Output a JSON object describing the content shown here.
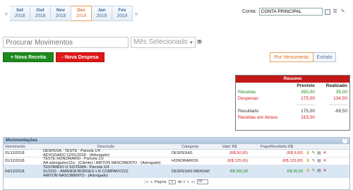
{
  "month_nav": {
    "months": [
      {
        "name": "Set",
        "year": "2018"
      },
      {
        "name": "Out",
        "year": "2018"
      },
      {
        "name": "Nov",
        "year": "2018"
      },
      {
        "name": "Dez",
        "year": "2018"
      },
      {
        "name": "Jan",
        "year": "2019"
      },
      {
        "name": "Fev",
        "year": "2019"
      }
    ],
    "active_index": 3,
    "prev_icon": "double-chevron-left-icon",
    "next_icon": "double-chevron-right-icon"
  },
  "conta": {
    "label": "Conta:",
    "selected": "CONTA PRINCIPAL"
  },
  "search": {
    "placeholder": "Procurar Movimentos",
    "month_select": "Mês Selecionado"
  },
  "actions": {
    "nova_receita": "+ Nova Receita",
    "nova_despesa": "- Nova Despesa",
    "por_vencimento": "Por Vencimento",
    "extrato": "Extrato"
  },
  "resumo": {
    "title": "Resumo",
    "col_previsto": "Previsto",
    "col_realizado": "Realizado",
    "rows": [
      {
        "label": "Receitas",
        "previsto": "350,00",
        "realizado": "35,00"
      },
      {
        "label": "Despesas",
        "previsto": "175,00",
        "realizado": "134,50"
      }
    ],
    "separator": "------------",
    "resultado": {
      "label": "Resultado",
      "previsto": "175,00",
      "realizado": "-99,50"
    },
    "atraso": {
      "label": "Receitas em Atraso",
      "previsto": "315,00",
      "realizado": ""
    }
  },
  "movimentacoes": {
    "title": "Movimentações",
    "columns": [
      "Vencimento",
      "Descrição",
      "Categoria",
      "Valor R$",
      "Pago/Recebido R$"
    ],
    "rows": [
      {
        "vencimento": "01/12/2018",
        "descricao_1": "DESPESA - TESTE - Parcela 1/4",
        "descricao_2": "ADVOGADO 12/01/2018 - (Advogado)",
        "categoria": "DESPESAS",
        "valor": "(R$ 50,00)",
        "pago": "(R$ 9,50)",
        "kind": "neg"
      },
      {
        "vencimento": "01/12/2018",
        "descricao_1": "TESTE HONORARIO - Parcela 1/2",
        "descricao_2": "AA advogados12a - (Cliente) / AIRTON NASCIMENTO - (Advogado)",
        "categoria": "HONORÁRIOS",
        "valor": "(R$ 125,00)",
        "pago": "(R$ 125,00)",
        "kind": "neg"
      },
      {
        "vencimento": "04/12/2018",
        "descricao_1": "TESTANDO O SISTEMA - Parcela 1/4",
        "descricao_2": "01/2011 - AMANDA BORGES x B COMPANYZZZ",
        "descricao_3": "AIRTON NASCIMENTO - (Advogado)",
        "categoria": "DESPESAS MENSAIS",
        "valor": "R$ 350,00",
        "pago": "R$ 35,00",
        "kind": "pos"
      }
    ],
    "pager": {
      "page_label": "Página",
      "page": "1",
      "of_label": "de 1",
      "page_size": "50"
    }
  }
}
